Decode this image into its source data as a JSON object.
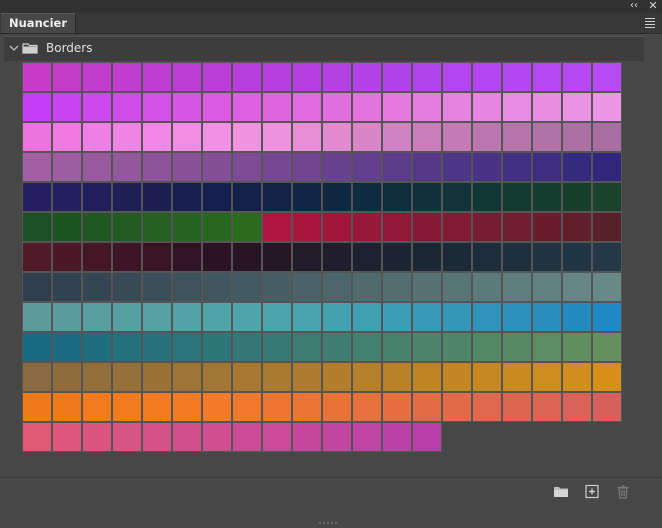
{
  "window": {
    "collapse_glyph": "‹‹",
    "close_glyph": "✕"
  },
  "panel": {
    "tab_label": "Nuancier",
    "menu_icon": "hamburger-menu-icon"
  },
  "group": {
    "name": "Borders",
    "expanded": true,
    "icon": "folder-icon"
  },
  "swatches": [
    "#c63cc6",
    "#c33cc9",
    "#c23ccc",
    "#c03dcf",
    "#be3dd2",
    "#bc3dd5",
    "#b93ed8",
    "#b83edb",
    "#b73fde",
    "#b540e1",
    "#b441e4",
    "#b342e7",
    "#b243ea",
    "#b244ec",
    "#b345ee",
    "#b346f0",
    "#b447f2",
    "#b548f3",
    "#b649f4",
    "#b74af5",
    "#c43ef7",
    "#c944f0",
    "#cd48ee",
    "#d04ce9",
    "#d451e6",
    "#d756e4",
    "#da5be2",
    "#dc60e1",
    "#de65e0",
    "#e06adf",
    "#e26fdf",
    "#e374df",
    "#e479df",
    "#e57ddf",
    "#e682e0",
    "#e786e1",
    "#e88be2",
    "#e98fe3",
    "#ea93e4",
    "#eb97e5",
    "#ec74e0",
    "#ee7ae2",
    "#ef7fe4",
    "#f084e5",
    "#f188e5",
    "#f28de5",
    "#f291e3",
    "#f094e0",
    "#ed92dc",
    "#e88ed6",
    "#e18ad0",
    "#d986c9",
    "#d182c2",
    "#c97ebb",
    "#c27bb5",
    "#bb78b0",
    "#b575ab",
    "#b072a7",
    "#ab70a4",
    "#a86ea2",
    "#a260a2",
    "#9d5da0",
    "#985a9e",
    "#93579c",
    "#8e549a",
    "#895198",
    "#834e96",
    "#7c4b94",
    "#764892",
    "#6f4590",
    "#68428e",
    "#623f8c",
    "#5b3c8a",
    "#553988",
    "#4e3686",
    "#483384",
    "#423082",
    "#3c2d80",
    "#362a7e",
    "#30277c",
    "#271f64",
    "#241f5f",
    "#211f5a",
    "#1e1f55",
    "#1b1f52",
    "#181f50",
    "#151f4d",
    "#13204a",
    "#122247",
    "#112545",
    "#102842",
    "#0f2b3f",
    "#0f2e3d",
    "#0f313a",
    "#103437",
    "#113734",
    "#133a31",
    "#153d2f",
    "#17402c",
    "#19432a",
    "#1b5025",
    "#1d5424",
    "#1f5823",
    "#215c22",
    "#236021",
    "#256420",
    "#27681f",
    "#296c1e",
    "#b0153f",
    "#a8163d",
    "#a0173b",
    "#981839",
    "#901937",
    "#881a35",
    "#801b33",
    "#781c31",
    "#701d2f",
    "#681e2d",
    "#601f2b",
    "#582029",
    "#501a28",
    "#4a1827",
    "#441626",
    "#3e1525",
    "#381424",
    "#321323",
    "#2c1323",
    "#271524",
    "#241826",
    "#221b29",
    "#201e2c",
    "#1e212f",
    "#1d2432",
    "#1c2735",
    "#1c2a38",
    "#1d2d3b",
    "#1e303e",
    "#1f3341",
    "#213644",
    "#233947",
    "#2f3d4d",
    "#324250",
    "#354653",
    "#384a56",
    "#3b4e59",
    "#3e525c",
    "#41565f",
    "#445a62",
    "#475e65",
    "#4a6268",
    "#4d666b",
    "#506a6e",
    "#536e71",
    "#567274",
    "#597677",
    "#5c7a7a",
    "#5f7e7d",
    "#628280",
    "#658683",
    "#688a86",
    "#5c9a9c",
    "#5a9c9e",
    "#589ea0",
    "#56a0a2",
    "#54a2a4",
    "#52a3a6",
    "#50a4a8",
    "#4ea5aa",
    "#4ba5ac",
    "#48a4ae",
    "#44a2b0",
    "#40a0b2",
    "#3c9db4",
    "#389ab6",
    "#3497b8",
    "#3094ba",
    "#2c91bc",
    "#288ebe",
    "#248bc0",
    "#2088c2",
    "#176a84",
    "#1b6c82",
    "#1f6e80",
    "#23707e",
    "#27727c",
    "#2b747a",
    "#2f7678",
    "#337876",
    "#377a74",
    "#3b7c72",
    "#3f7e70",
    "#43806e",
    "#47826c",
    "#4b846a",
    "#4f8668",
    "#538866",
    "#578a64",
    "#5b8c62",
    "#5f8e60",
    "#63905e",
    "#8a6a40",
    "#8e6c3e",
    "#926e3c",
    "#96703a",
    "#9a7238",
    "#9e7436",
    "#a27634",
    "#a67832",
    "#aa7a30",
    "#ae7c2e",
    "#b27e2c",
    "#b6802a",
    "#ba8228",
    "#be8426",
    "#c28624",
    "#c68822",
    "#ca8a20",
    "#ce8c1e",
    "#d28e1c",
    "#d6901a",
    "#ee7a18",
    "#f07a1a",
    "#f27a1c",
    "#f47a1e",
    "#f67a20",
    "#f47a24",
    "#f27a28",
    "#f0782c",
    "#ee7630",
    "#ec7434",
    "#ea7238",
    "#e8703c",
    "#e66e40",
    "#e46c44",
    "#e26a48",
    "#e0684c",
    "#de6650",
    "#dc6454",
    "#da6258",
    "#d8605c",
    "#e05a78",
    "#dd587c",
    "#da5680",
    "#d75484",
    "#d45288",
    "#d1508c",
    "#ce4e90",
    "#cb4c94",
    "#c84a98",
    "#c5489c",
    "#c246a0",
    "#bf44a4",
    "#bc42a8",
    "#b940ac"
  ],
  "footer": {
    "folder_icon": "new-group-folder-icon",
    "add_icon": "new-swatch-icon",
    "delete_icon": "trash-icon"
  }
}
